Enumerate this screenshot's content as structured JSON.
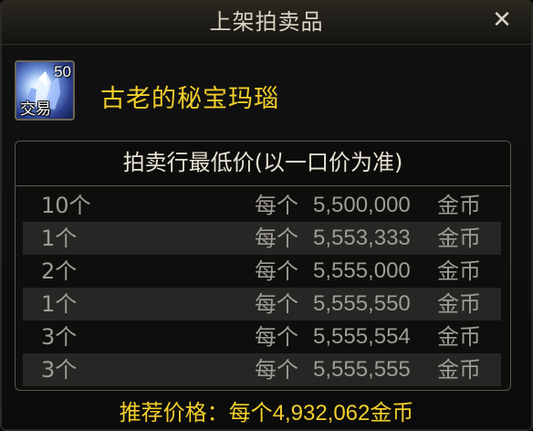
{
  "dialog": {
    "title": "上架拍卖品",
    "close_icon": "close-icon"
  },
  "item": {
    "icon": "crystal-item-icon",
    "level": "50",
    "tag": "交易",
    "name": "古老的秘宝玛瑙"
  },
  "table": {
    "header": "拍卖行最低价(以一口价为准)",
    "rows": [
      {
        "qty": "10个",
        "each": "每个",
        "price": "5,500,000",
        "unit": "金币"
      },
      {
        "qty": "1个",
        "each": "每个",
        "price": "5,553,333",
        "unit": "金币"
      },
      {
        "qty": "2个",
        "each": "每个",
        "price": "5,555,000",
        "unit": "金币"
      },
      {
        "qty": "1个",
        "each": "每个",
        "price": "5,555,550",
        "unit": "金币"
      },
      {
        "qty": "3个",
        "each": "每个",
        "price": "5,555,554",
        "unit": "金币"
      },
      {
        "qty": "3个",
        "each": "每个",
        "price": "5,555,555",
        "unit": "金币"
      }
    ]
  },
  "recommend": {
    "label": "推荐价格：每个",
    "price": "4,932,062",
    "unit": "金币"
  },
  "colors": {
    "accent_gold": "#f2cf2c",
    "row_text": "#9f9c93"
  }
}
